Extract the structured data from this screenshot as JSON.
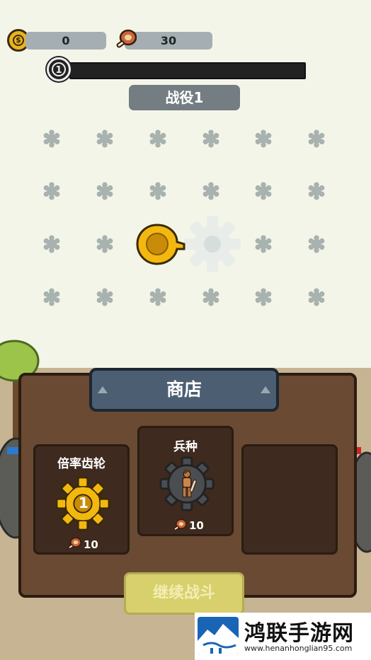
{
  "hud": {
    "coins": "0",
    "meat": "30",
    "level": "1",
    "battle_title": "战役1"
  },
  "shop": {
    "title": "商店",
    "items": [
      {
        "name": "倍率齿轮",
        "badge": "1",
        "price": "10"
      },
      {
        "name": "兵种",
        "price": "10"
      },
      {
        "name": "",
        "price": ""
      }
    ],
    "continue_label": "继续战斗"
  },
  "watermark": {
    "title": "鸿联手游网",
    "url": "www.henanhonglian95.com"
  },
  "colors": {
    "gear_slot": "#a8b2ae",
    "gold": "#f0b30f",
    "panel_wood": "#6a4a33",
    "banner": "#4c5f72"
  }
}
